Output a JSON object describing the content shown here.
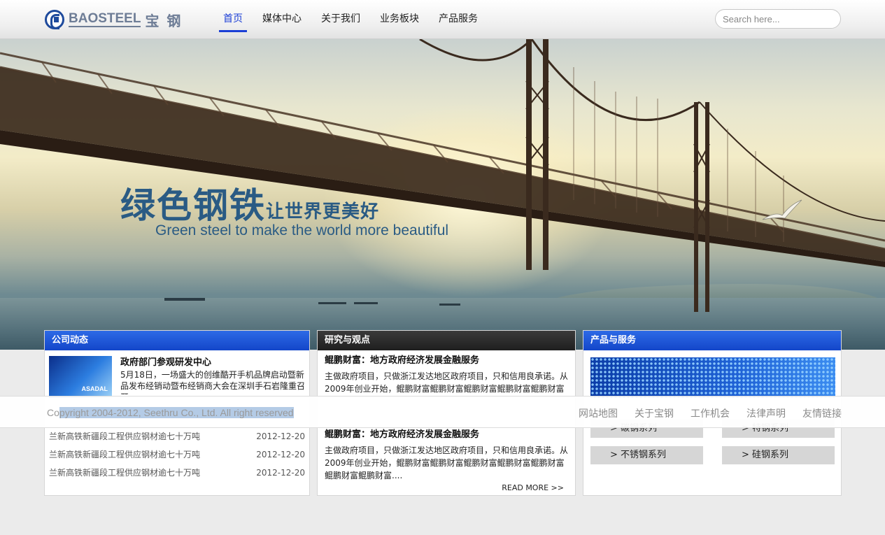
{
  "brand": {
    "name_en": "BAOSTEEL",
    "name_cn": "宝 钢"
  },
  "nav": {
    "items": [
      "首页",
      "媒体中心",
      "关于我们",
      "业务板块",
      "产品服务"
    ],
    "active": "首页"
  },
  "search": {
    "placeholder": "Search here..."
  },
  "banner": {
    "title_cn_main": "绿色钢铁",
    "title_cn_sub": "让世界更美好",
    "title_en": "Green steel to make the world more beautiful"
  },
  "company_news": {
    "heading": "公司动态",
    "feature": {
      "image_label": "ASADAL",
      "title": "政府部门参观研发中心",
      "text": "5月18日，一场盛大的创维酷开手机品牌启动暨新品发布经销动暨布经销商大会在深圳手石岩隆重召开"
    },
    "items": [
      {
        "title": "兰新高铁新疆段工程供应钢材逾七十万吨",
        "date": "2012-12-20"
      },
      {
        "title": "兰新高铁新疆段工程供应钢材逾七十万吨",
        "date": "2012-12-20"
      },
      {
        "title": "兰新高铁新疆段工程供应钢材逾七十万吨",
        "date": "2012-12-20"
      }
    ]
  },
  "research": {
    "heading": "研究与观点",
    "articles": [
      {
        "title": "鲲鹏财富：地方政府经济发展金融服务",
        "text": "主做政府项目，只做浙江发达地区政府项目，只和信用良承诺。从2009年创业开始，鲲鹏财富鲲鹏财富鲲鹏财富鲲鹏财富鲲鹏财富鲲鹏财富...."
      },
      {
        "title": "鲲鹏财富：地方政府经济发展金融服务",
        "text": "主做政府项目，只做浙江发达地区政府项目，只和信用良承诺。从2009年创业开始，鲲鹏财富鲲鹏财富鲲鹏财富鲲鹏财富鲲鹏财富鲲鹏财富鲲鹏财富...."
      }
    ],
    "read_more": "READ MORE >>"
  },
  "products": {
    "heading": "产品与服务",
    "buttons": [
      "> 碳钢系列",
      "> 特钢系列",
      "> 不锈钢系列",
      "> 硅钢系列"
    ]
  },
  "footer": {
    "copyright_prefix": "Co",
    "copyright_selected": "pyright 2004-2012, Seethru Co., Ltd. All right reserved",
    "links": [
      "网站地图",
      "关于宝钢",
      "工作机会",
      "法律声明",
      "友情链接"
    ]
  }
}
